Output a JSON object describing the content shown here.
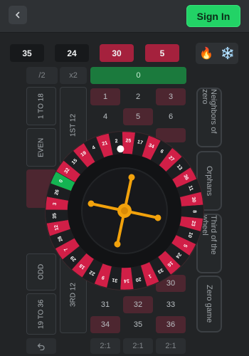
{
  "header": {
    "back_icon": "chevron-left-icon",
    "signin_label": "Sign In",
    "signin_color": "#22d366"
  },
  "history": [
    {
      "value": "35",
      "color": "black"
    },
    {
      "value": "24",
      "color": "black"
    },
    {
      "value": "30",
      "color": "red"
    },
    {
      "value": "5",
      "color": "red"
    }
  ],
  "hot_cold": {
    "hot_icon": "fire-icon",
    "cold_icon": "snowflake-icon",
    "hot_glyph": "🔥",
    "cold_glyph": "❄️"
  },
  "bet_controls": {
    "half_label": "/2",
    "double_label": "x2",
    "undo_icon": "undo-icon"
  },
  "table": {
    "zero": "0",
    "columns_bottom": [
      "2:1",
      "2:1",
      "2:1"
    ],
    "outside": [
      "1 TO 18",
      "EVEN",
      "ODD",
      "19 TO 36"
    ],
    "dozens": [
      "1ST 12",
      "3RD 12"
    ],
    "numbers": [
      {
        "n": "1",
        "color": "red"
      },
      {
        "n": "2",
        "color": "black"
      },
      {
        "n": "3",
        "color": "red"
      },
      {
        "n": "4",
        "color": "black"
      },
      {
        "n": "5",
        "color": "red"
      },
      {
        "n": "6",
        "color": "black"
      },
      {
        "n": "30",
        "color": "red"
      },
      {
        "n": "31",
        "color": "black"
      },
      {
        "n": "32",
        "color": "red"
      },
      {
        "n": "33",
        "color": "black"
      },
      {
        "n": "34",
        "color": "red"
      },
      {
        "n": "35",
        "color": "black"
      },
      {
        "n": "36",
        "color": "red"
      }
    ]
  },
  "special_bets": [
    "Neighbors of zero",
    "Orphans",
    "Third of the wheel",
    "Zero game"
  ],
  "wheel": {
    "sequence": [
      "0",
      "32",
      "15",
      "19",
      "4",
      "21",
      "2",
      "25",
      "17",
      "34",
      "6",
      "27",
      "13",
      "36",
      "11",
      "30",
      "8",
      "23",
      "10",
      "5",
      "24",
      "16",
      "33",
      "1",
      "20",
      "14",
      "31",
      "9",
      "22",
      "18",
      "29",
      "7",
      "28",
      "12",
      "35",
      "3",
      "26"
    ],
    "red_numbers": [
      "1",
      "3",
      "5",
      "7",
      "9",
      "12",
      "14",
      "16",
      "18",
      "19",
      "21",
      "23",
      "25",
      "27",
      "30",
      "32",
      "34",
      "36"
    ],
    "colors": {
      "red": "#d11f47",
      "black": "#1c1e21",
      "green": "#14b452",
      "rim": "#3a2b2f",
      "hub": "#f2a20c",
      "ball": "#ffffff"
    }
  }
}
